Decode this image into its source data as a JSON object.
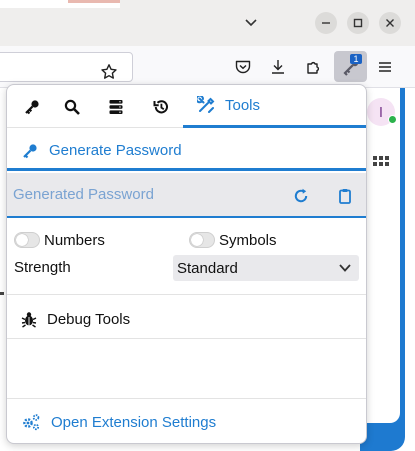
{
  "colors": {
    "accent": "#1f7dd0",
    "badge": "#1a62c4",
    "page_blue": "#1e7ad0"
  },
  "window_controls": {
    "icons": [
      "chevron-down-icon",
      "minimize-icon",
      "maximize-icon",
      "close-icon"
    ]
  },
  "toolbar": {
    "icons": [
      "bookmark-star-icon",
      "pocket-icon",
      "download-icon",
      "extensions-icon",
      "keepassxc-icon",
      "hamburger-menu-icon"
    ],
    "extension_badge": "1"
  },
  "page": {
    "avatar_letter": "I"
  },
  "popup": {
    "tabs": {
      "icons": [
        "key-icon",
        "search-icon",
        "database-icon",
        "history-icon",
        "tools-icon"
      ],
      "tools_label": "Tools"
    },
    "generate_label": "Generate Password",
    "generated_placeholder": "Generated Password",
    "options": {
      "numbers_label": "Numbers",
      "symbols_label": "Symbols",
      "strength_label": "Strength",
      "strength_value": "Standard"
    },
    "debug_label": "Debug Tools",
    "settings_label": "Open Extension Settings"
  }
}
